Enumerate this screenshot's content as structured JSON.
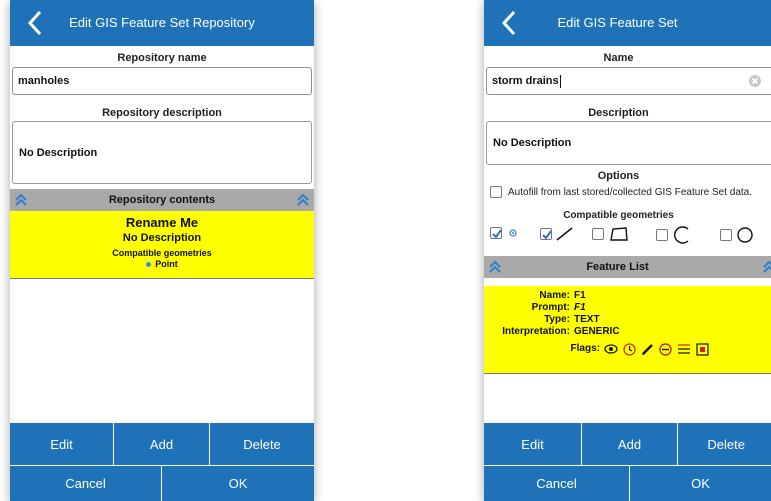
{
  "left": {
    "title": "Edit GIS Feature Set Repository",
    "repo_name_label": "Repository name",
    "repo_name_value": "manholes",
    "repo_desc_label": "Repository description",
    "repo_desc_value": "No Description",
    "contents_label": "Repository contents",
    "item": {
      "name": "Rename Me",
      "description": "No Description",
      "geometries_label": "Compatible geometries",
      "geometry": "Point"
    },
    "buttons": {
      "edit": "Edit",
      "add": "Add",
      "delete": "Delete",
      "cancel": "Cancel",
      "ok": "OK"
    }
  },
  "right": {
    "title": "Edit GIS Feature Set",
    "name_label": "Name",
    "name_value": "storm drains",
    "desc_label": "Description",
    "desc_value": "No Description",
    "options_label": "Options",
    "autofill_label": "Autofill from last stored/collected GIS Feature Set data.",
    "geometries_label": "Compatible geometries",
    "geometry_checks": {
      "point": true,
      "line": true,
      "polygon": false,
      "arc": false,
      "circle": false
    },
    "feature_list_label": "Feature List",
    "feature": {
      "name_key": "Name:",
      "name_val": "F1",
      "prompt_key": "Prompt:",
      "prompt_val": "F1",
      "type_key": "Type:",
      "type_val": "TEXT",
      "interp_key": "Interpretation:",
      "interp_val": "GENERIC",
      "flags_key": "Flags:"
    },
    "buttons": {
      "edit": "Edit",
      "add": "Add",
      "delete": "Delete",
      "cancel": "Cancel",
      "ok": "OK"
    }
  },
  "colors": {
    "accent": "#1f71b8",
    "highlight": "#ffff00",
    "bar": "#a9a9a9"
  }
}
